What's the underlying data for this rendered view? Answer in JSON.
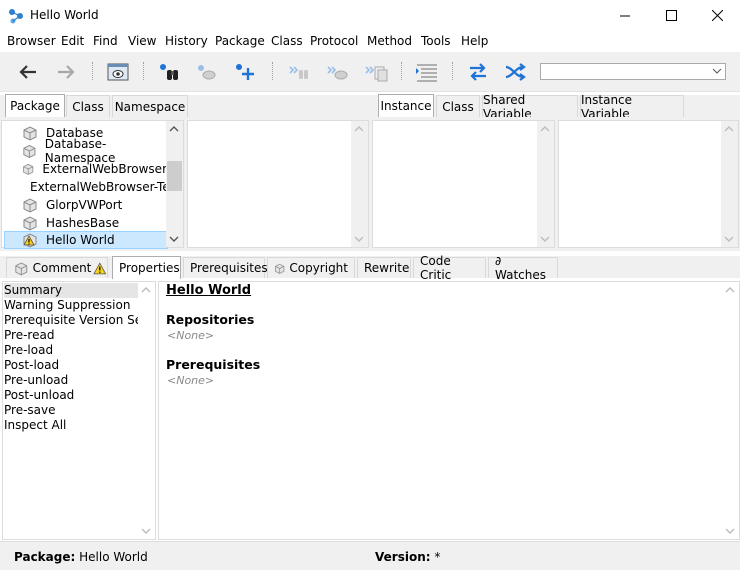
{
  "window": {
    "title": "Hello World",
    "icon": "app-icon",
    "controls": [
      "minimize-icon",
      "maximize-icon",
      "close-icon"
    ]
  },
  "menubar": {
    "items": [
      {
        "label": "Browser"
      },
      {
        "label": "Edit"
      },
      {
        "label": "Find"
      },
      {
        "label": "View"
      },
      {
        "label": "History"
      },
      {
        "label": "Package"
      },
      {
        "label": "Class"
      },
      {
        "label": "Protocol"
      },
      {
        "label": "Method"
      },
      {
        "label": "Tools"
      },
      {
        "label": "Help"
      }
    ]
  },
  "toolbar": {
    "icons": [
      "back-arrow-icon",
      "forward-arrow-icon",
      "browse-window-icon",
      "senders-icon",
      "implementors-icon",
      "add-icon",
      "step-in-icon",
      "step-over-icon",
      "references-icon",
      "format-icon",
      "refresh-icon",
      "shuffle-icon"
    ],
    "search_value": ""
  },
  "top_tabs_left": [
    "Package",
    "Class",
    "Namespace"
  ],
  "top_tabs_right": [
    "Instance",
    "Class",
    "Shared Variable",
    "Instance Variable"
  ],
  "package_list": [
    {
      "label": "Database",
      "icon": "package-icon"
    },
    {
      "label": "Database-Namespace",
      "icon": "package-icon"
    },
    {
      "label": "ExternalWebBrowser",
      "icon": "package-icon"
    },
    {
      "label": "ExternalWebBrowser-Te",
      "icon": "package-icon"
    },
    {
      "label": "GlorpVWPort",
      "icon": "package-icon"
    },
    {
      "label": "HashesBase",
      "icon": "package-icon"
    },
    {
      "label": "Hello World",
      "icon": "package-warning-icon",
      "selected": true
    }
  ],
  "lower_tabs": [
    {
      "label": "Comment",
      "icon": "package-icon",
      "badge": "warning-icon"
    },
    {
      "label": "Properties",
      "active": true
    },
    {
      "label": "Prerequisites"
    },
    {
      "label": "Copyright",
      "icon": "package-icon"
    },
    {
      "label": "Rewrite"
    },
    {
      "label": "Code Critic"
    },
    {
      "label": "∂ Watches"
    }
  ],
  "properties_list": [
    {
      "label": "Summary",
      "selected": true
    },
    {
      "label": "Warning Suppression"
    },
    {
      "label": "Prerequisite Version Selec"
    },
    {
      "label": "Pre-read"
    },
    {
      "label": "Pre-load"
    },
    {
      "label": "Post-load"
    },
    {
      "label": "Pre-unload"
    },
    {
      "label": "Post-unload"
    },
    {
      "label": "Pre-save"
    },
    {
      "label": "Inspect All"
    }
  ],
  "document": {
    "title": "Hello World",
    "repositories_heading": "Repositories",
    "repositories_value": "<None>",
    "prerequisites_heading": "Prerequisites",
    "prerequisites_value": "<None>"
  },
  "status": {
    "package_label": "Package:",
    "package_value": "Hello World",
    "version_label": "Version:",
    "version_value": "*"
  },
  "colors": {
    "selection": "#cce8ff",
    "chrome": "#f0f0f0",
    "accent_blue": "#1e73d8"
  }
}
